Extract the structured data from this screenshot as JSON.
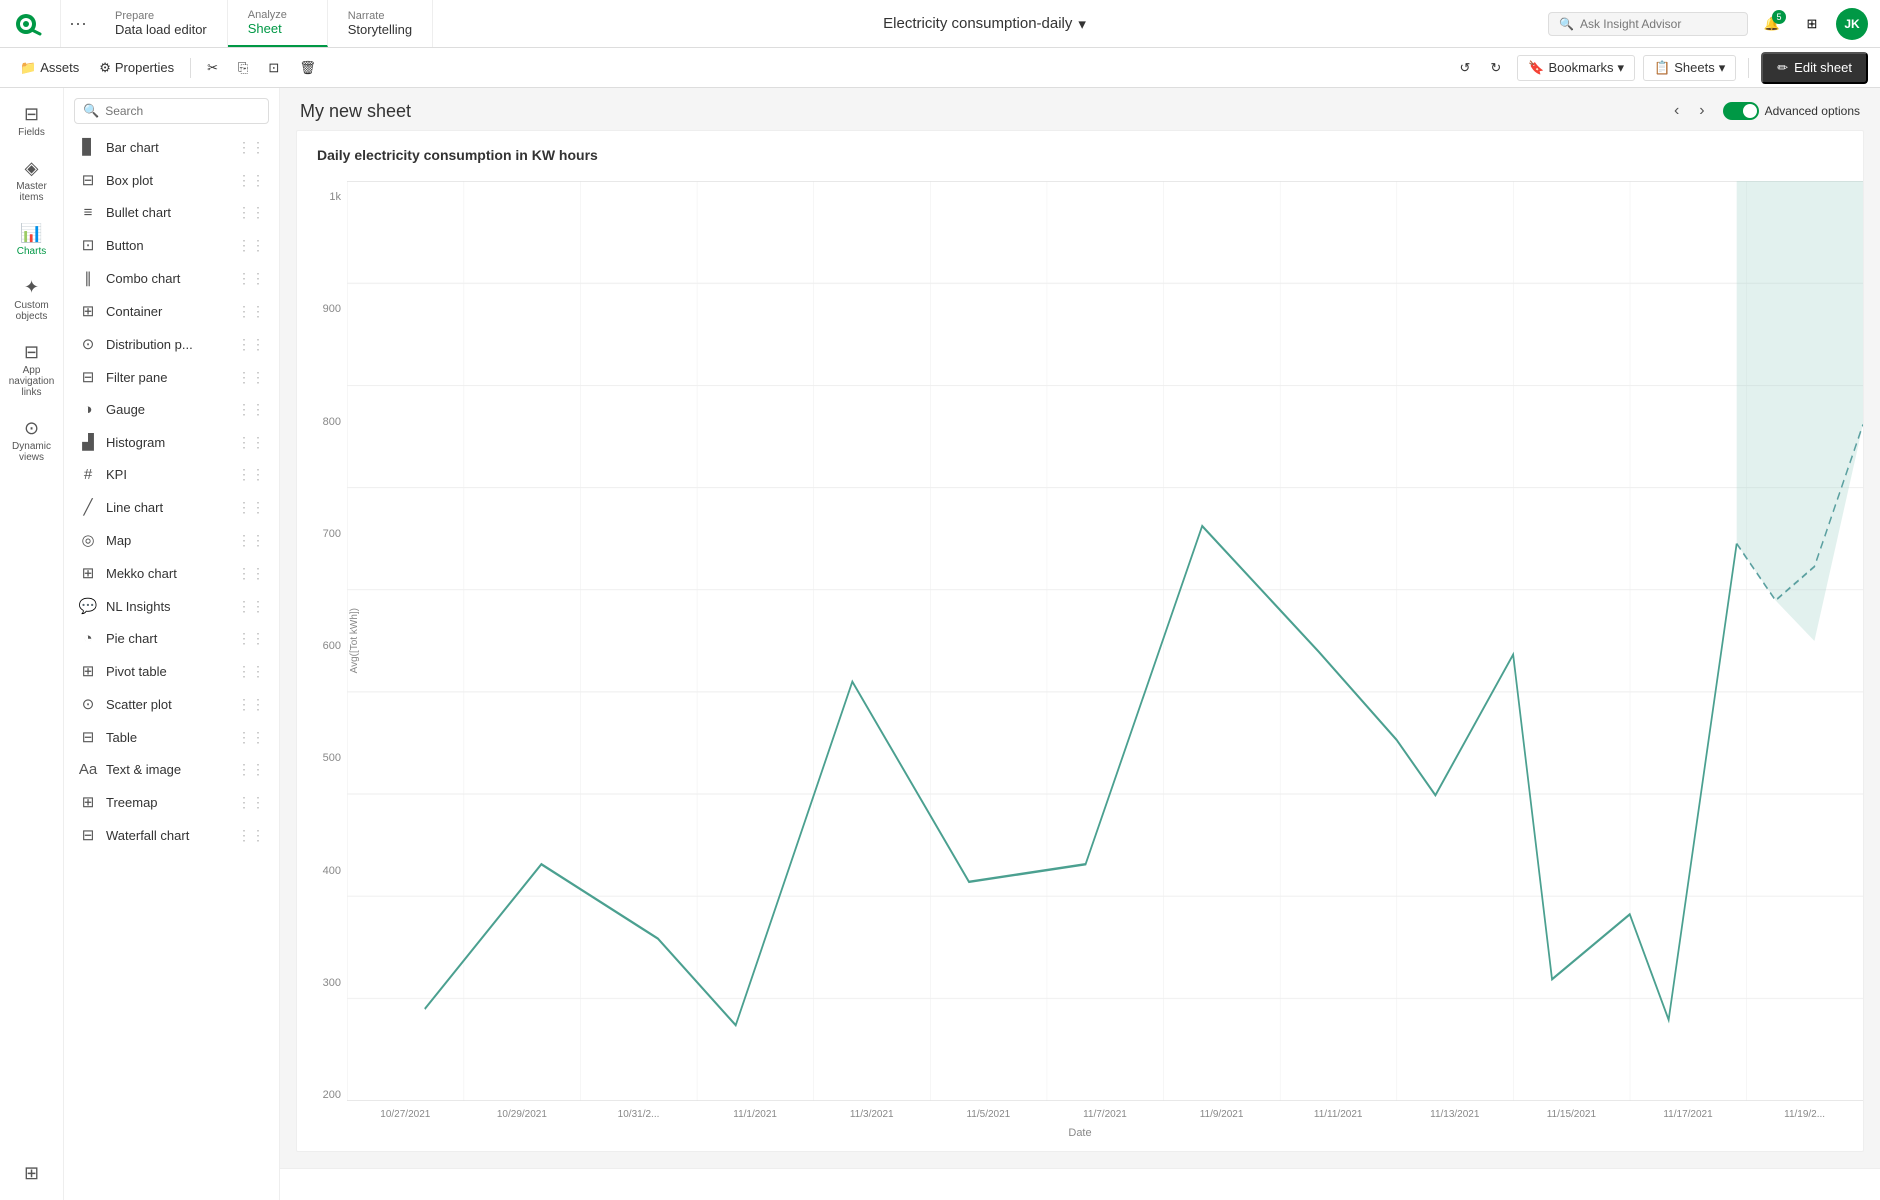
{
  "app": {
    "title": "Electricity consumption-daily",
    "logo_text": "Qlik"
  },
  "nav": {
    "tabs": [
      {
        "id": "prepare",
        "title": "Prepare",
        "subtitle": "Data load editor"
      },
      {
        "id": "analyze",
        "title": "Analyze",
        "subtitle": "Sheet",
        "active": true
      },
      {
        "id": "narrate",
        "title": "Narrate",
        "subtitle": "Storytelling"
      }
    ],
    "insight_advisor_label": "Ask Insight Advisor",
    "notification_badge": "5",
    "user_initials": "JK"
  },
  "toolbar": {
    "assets_label": "Assets",
    "properties_label": "Properties",
    "bookmarks_label": "Bookmarks",
    "sheets_label": "Sheets",
    "edit_sheet_label": "Edit sheet"
  },
  "sidebar": {
    "items": [
      {
        "id": "fields",
        "label": "Fields",
        "icon": "▤"
      },
      {
        "id": "master-items",
        "label": "Master items",
        "icon": "⊞"
      },
      {
        "id": "charts",
        "label": "Charts",
        "icon": "📊",
        "active": true
      },
      {
        "id": "custom-objects",
        "label": "Custom objects",
        "icon": "✦"
      },
      {
        "id": "app-navigation",
        "label": "App navigation links",
        "icon": "⊟"
      },
      {
        "id": "dynamic-views",
        "label": "Dynamic views",
        "icon": "⊙"
      }
    ]
  },
  "charts_panel": {
    "search_placeholder": "Search",
    "items": [
      {
        "id": "bar-chart",
        "name": "Bar chart",
        "icon": "▊"
      },
      {
        "id": "box-plot",
        "name": "Box plot",
        "icon": "⊟"
      },
      {
        "id": "bullet-chart",
        "name": "Bullet chart",
        "icon": "≡"
      },
      {
        "id": "button",
        "name": "Button",
        "icon": "⊡"
      },
      {
        "id": "combo-chart",
        "name": "Combo chart",
        "icon": "∥"
      },
      {
        "id": "container",
        "name": "Container",
        "icon": "⊞"
      },
      {
        "id": "distribution-plot",
        "name": "Distribution p...",
        "icon": "⊙"
      },
      {
        "id": "filter-pane",
        "name": "Filter pane",
        "icon": "⊟"
      },
      {
        "id": "gauge",
        "name": "Gauge",
        "icon": "◑"
      },
      {
        "id": "histogram",
        "name": "Histogram",
        "icon": "▟"
      },
      {
        "id": "kpi",
        "name": "KPI",
        "icon": "#"
      },
      {
        "id": "line-chart",
        "name": "Line chart",
        "icon": "╱"
      },
      {
        "id": "map",
        "name": "Map",
        "icon": "◎"
      },
      {
        "id": "mekko-chart",
        "name": "Mekko chart",
        "icon": "⊞"
      },
      {
        "id": "nl-insights",
        "name": "NL Insights",
        "icon": "💬"
      },
      {
        "id": "pie-chart",
        "name": "Pie chart",
        "icon": "◔"
      },
      {
        "id": "pivot-table",
        "name": "Pivot table",
        "icon": "⊞"
      },
      {
        "id": "scatter-plot",
        "name": "Scatter plot",
        "icon": "⊙"
      },
      {
        "id": "table",
        "name": "Table",
        "icon": "⊟"
      },
      {
        "id": "text-image",
        "name": "Text & image",
        "icon": "Aa"
      },
      {
        "id": "treemap",
        "name": "Treemap",
        "icon": "⊞"
      },
      {
        "id": "waterfall-chart",
        "name": "Waterfall chart",
        "icon": "⊟"
      }
    ]
  },
  "sheet": {
    "title": "My new sheet",
    "chart_title": "Daily electricity consumption in KW hours",
    "advanced_options_label": "Advanced options",
    "x_axis_label": "Date",
    "y_axis_label": "Avg([Tot kWh])",
    "y_axis_values": [
      "1k",
      "900",
      "800",
      "700",
      "600",
      "500",
      "400",
      "300",
      "200"
    ],
    "x_axis_dates": [
      "10/27/2021",
      "10/29/2021",
      "10/31/2...",
      "11/1/2021",
      "11/3/2021",
      "11/5/2021",
      "11/7/2021",
      "11/9/2021",
      "11/11/2021",
      "11/13/2021",
      "11/15/2021",
      "11/17/2021",
      "11/19/2..."
    ]
  }
}
